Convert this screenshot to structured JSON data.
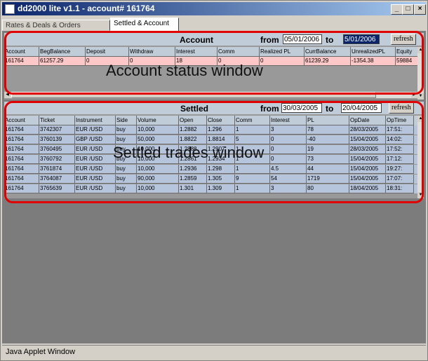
{
  "window": {
    "title": "dd2000 lite v1.1 - account# 161764"
  },
  "window_buttons": {
    "minimize": "_",
    "maximize": "□",
    "close": "×"
  },
  "tabs": [
    {
      "label": "Rates & Deals & Orders",
      "active": false
    },
    {
      "label": "Settled & Account",
      "active": true
    }
  ],
  "account_panel": {
    "title": "Account",
    "from_label": "from",
    "from_value": "05/01/2006",
    "to_label": "to",
    "to_value": "5/01/2006",
    "refresh_label": "refresh",
    "columns": [
      "Account",
      "BegBalance",
      "Deposit",
      "Withdraw",
      "Interest",
      "Comm",
      "Realized PL",
      "CurrBalance",
      "UnrealizedPL",
      "Equity"
    ],
    "rows": [
      [
        "161764",
        "61257.29",
        "0",
        "0",
        "18",
        "0",
        "0",
        "61239.29",
        "-1354.38",
        "59884"
      ]
    ],
    "row_color": "#ffc8c8",
    "annotation": "Account status window"
  },
  "settled_panel": {
    "title": "Settled",
    "from_label": "from",
    "from_value": "30/03/2005",
    "to_label": "to",
    "to_value": "20/04/2005",
    "refresh_label": "refresh",
    "columns": [
      "Account",
      "Ticket",
      "Instrument",
      "Side",
      "Volume",
      "Open",
      "Close",
      "Comm",
      "Interest",
      "PL",
      "OpDate",
      "OpTime"
    ],
    "rows": [
      [
        "161764",
        "3742307",
        "EUR /USD",
        "buy",
        "10,000",
        "1.2882",
        "1.296",
        "1",
        "3",
        "78",
        "28/03/2005",
        "17:51:"
      ],
      [
        "161764",
        "3760139",
        "GBP /USD",
        "buy",
        "50,000",
        "1.8822",
        "1.8814",
        "5",
        "0",
        "-40",
        "15/04/2005",
        "14:02:"
      ],
      [
        "161764",
        "3760495",
        "EUR /USD",
        "buy",
        "10,000",
        "1.2888",
        "1.2907",
        "1",
        "0",
        "19",
        "28/03/2005",
        "17:52:"
      ],
      [
        "161764",
        "3760792",
        "EUR /USD",
        "buy",
        "10,000",
        "1.2861",
        "1.2934",
        "1",
        "0",
        "73",
        "15/04/2005",
        "17:12:"
      ],
      [
        "161764",
        "3761874",
        "EUR /USD",
        "buy",
        "10,000",
        "1.2936",
        "1.298",
        "1",
        "4.5",
        "44",
        "15/04/2005",
        "19:27:"
      ],
      [
        "161764",
        "3764087",
        "EUR /USD",
        "buy",
        "90,000",
        "1.2859",
        "1.305",
        "9",
        "54",
        "1719",
        "15/04/2005",
        "17:07:"
      ],
      [
        "161764",
        "3765639",
        "EUR /USD",
        "buy",
        "10,000",
        "1.301",
        "1.309",
        "1",
        "3",
        "80",
        "18/04/2005",
        "18:31:"
      ]
    ],
    "row_color": "#b6c4dc",
    "annotation": "Settled trades window"
  },
  "status_bar": {
    "text": "Java Applet Window"
  },
  "colors": {
    "annotation_border": "#e00000",
    "title_bar": "#0a246a",
    "header_bg": "#c0ccd8"
  }
}
